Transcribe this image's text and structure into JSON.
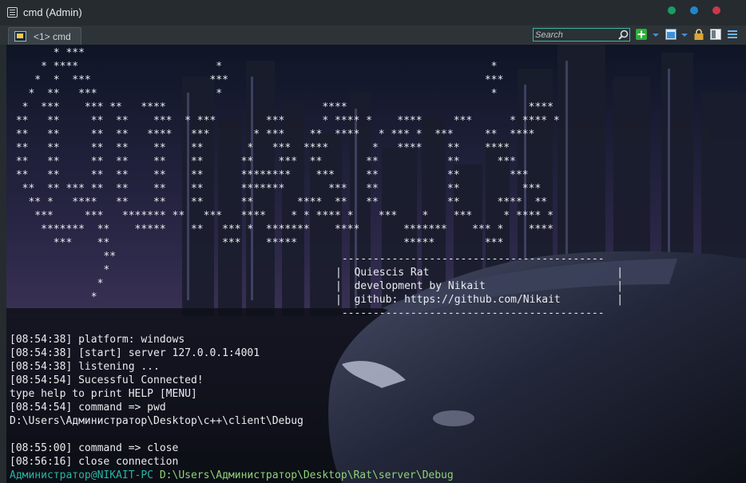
{
  "window": {
    "title": "cmd (Admin)"
  },
  "colors": {
    "dot_green": "#1a9c62",
    "dot_blue": "#1f87c9",
    "dot_red": "#c9394a",
    "accent": "#3fb4a8"
  },
  "tabs": [
    {
      "label": "<1> cmd",
      "icon": "console-icon"
    }
  ],
  "toolbar": {
    "search_placeholder": "Search",
    "icons": [
      "search-icon",
      "add-console-icon",
      "dropdown-arrow",
      "window-layout-icon",
      "dropdown-arrow",
      "lock-icon",
      "split-pane-icon",
      "menu-icon"
    ]
  },
  "terminal": {
    "ascii_art": "       * ***\n     * ****                      *                                           *\n    *  *  ***                   ***                                         ***\n   *  **   ***                   *                                           *\n  *  ***    *** **   ****                         ****                             ****\n **   **     **  **    ***  * ***        ***      * **** *    ****     ***      * **** *\n **   **     **  **   ****   ***       * ***    **  ****   * *** *  ***     **  ****\n **   **     **  **    **    **       *   ***  ****       *   ****    **    ****\n **   **     **  **    **    **      **    ***  **       **           **      ***\n **   **     **  **    **    **      ********    ***     **           **        ***\n  **  ** *** **  **    **    **      *******       ***   **           **          ***\n   ** *   ****   **    **    **      **       ****  **   **           **      ****  **\n    ***     ***   ******* **   ***   ****    * * **** *    ***    *    ***     * **** *\n     *******  **    *****    **   *** *  *******    ****       *******    *** *    ****\n       ***    **                  ***    *****                 *****        ***\n               **\n               *\n              *\n             *",
    "banner": " ------------------------------------------\n|  Quiescis Rat                              |\n|  development by Nikait                     |\n|  github: https://github.com/Nikait         |\n ------------------------------------------",
    "log_lines": [
      "[08:54:38] platform: windows",
      "[08:54:38] [start] server 127.0.0.1:4001",
      "[08:54:38] listening ...",
      "[08:54:54] Sucessful Connected!",
      "type help to print HELP [MENU]",
      "[08:54:54] command => pwd",
      "D:\\Users\\Администратор\\Desktop\\c++\\client\\Debug",
      "",
      "[08:55:00] command => close",
      "[08:56:16] close connection"
    ],
    "prompt": {
      "user": "Администратор@NIKAIT-PC",
      "path": "D:\\Users\\Администратор\\Desktop\\Rat\\server\\Debug"
    }
  }
}
